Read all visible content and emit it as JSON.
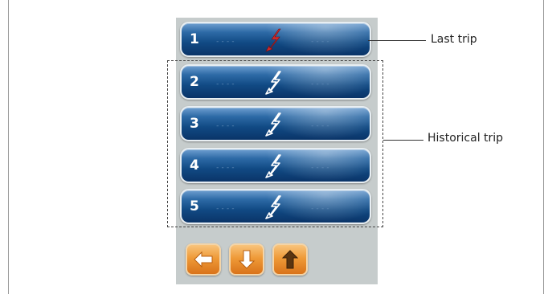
{
  "callouts": {
    "last_trip": "Last trip",
    "historical_trip": "Historical trip"
  },
  "trips": [
    {
      "number": "1",
      "left_value": "----",
      "right_value": "----",
      "icon": "lightning-bolt-icon",
      "icon_color": "#d42a2a"
    },
    {
      "number": "2",
      "left_value": "----",
      "right_value": "----",
      "icon": "lightning-bolt-icon",
      "icon_color": "#ffffff"
    },
    {
      "number": "3",
      "left_value": "----",
      "right_value": "----",
      "icon": "lightning-bolt-icon",
      "icon_color": "#ffffff"
    },
    {
      "number": "4",
      "left_value": "----",
      "right_value": "----",
      "icon": "lightning-bolt-icon",
      "icon_color": "#ffffff"
    },
    {
      "number": "5",
      "left_value": "----",
      "right_value": "----",
      "icon": "lightning-bolt-icon",
      "icon_color": "#ffffff"
    }
  ],
  "navigation": {
    "back_icon": "arrow-left-icon",
    "down_icon": "arrow-down-icon",
    "up_icon": "arrow-up-icon"
  },
  "colors": {
    "panel_background": "#c6cccc",
    "row_blue": "#114a84",
    "button_orange": "#ef9a38",
    "last_trip_bolt": "#d42a2a"
  }
}
